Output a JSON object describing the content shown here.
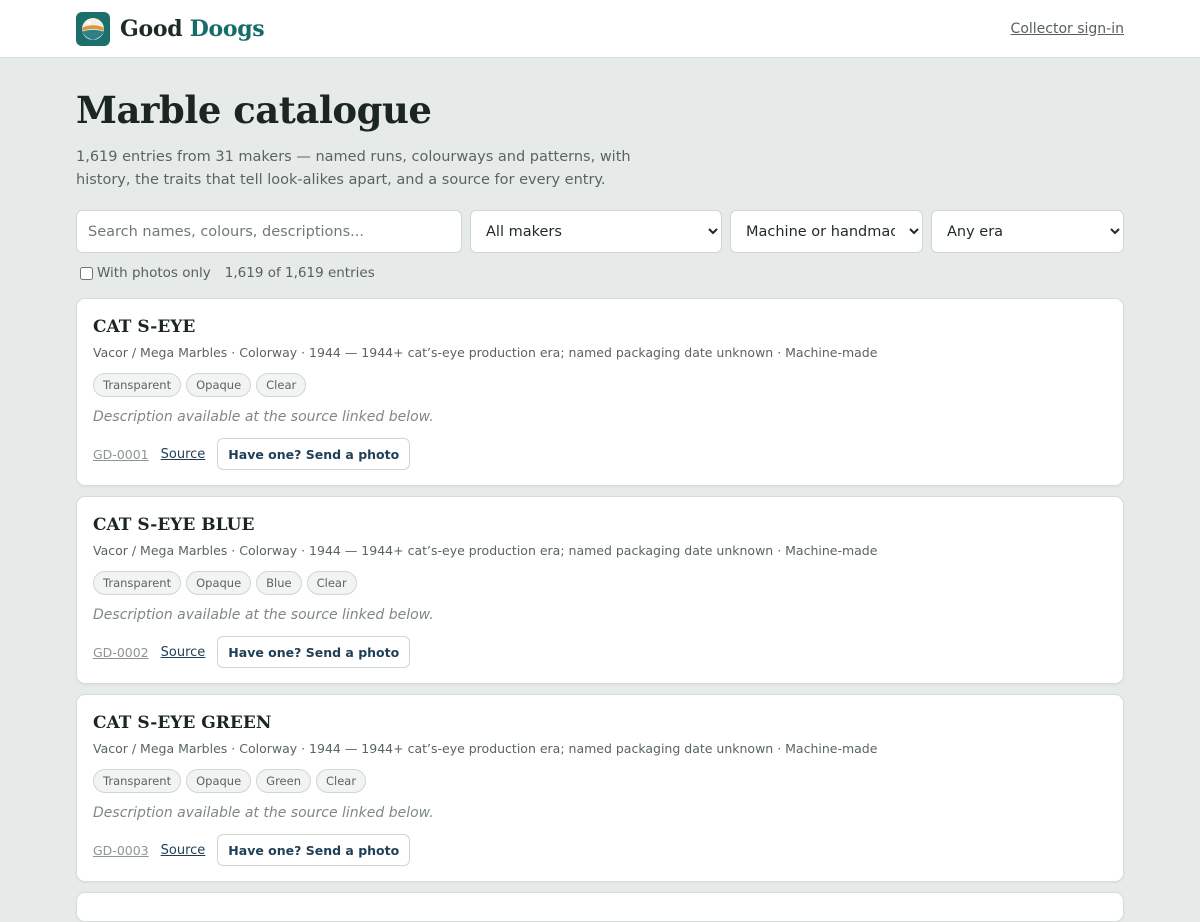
{
  "brand": {
    "name_part1": "Good",
    "name_part2": "Doogs"
  },
  "header": {
    "signin_label": "Collector sign-in"
  },
  "page": {
    "title": "Marble catalogue",
    "intro": "1,619 entries from 31 makers — named runs, colourways and patterns, with history, the traits that tell look-alikes apart, and a source for every entry."
  },
  "filters": {
    "search_placeholder": "Search names, colours, descriptions...",
    "maker_selected": "All makers",
    "method_selected": "Machine or handmade",
    "era_selected": "Any era",
    "photos_only_label": "With photos only",
    "photos_only_checked": false,
    "count_text": "1,619 of 1,619 entries"
  },
  "entries": [
    {
      "name": "CAT S-EYE",
      "meta": "Vacor / Mega Marbles · Colorway · 1944 — 1944+ cat’s-eye production era; named packaging date unknown · Machine-made",
      "tags": [
        "Transparent",
        "Opaque",
        "Clear"
      ],
      "description": "Description available at the source linked below.",
      "id": "GD-0001",
      "source_label": "Source",
      "action_label": "Have one? Send a photo"
    },
    {
      "name": "CAT S-EYE BLUE",
      "meta": "Vacor / Mega Marbles · Colorway · 1944 — 1944+ cat’s-eye production era; named packaging date unknown · Machine-made",
      "tags": [
        "Transparent",
        "Opaque",
        "Blue",
        "Clear"
      ],
      "description": "Description available at the source linked below.",
      "id": "GD-0002",
      "source_label": "Source",
      "action_label": "Have one? Send a photo"
    },
    {
      "name": "CAT S-EYE GREEN",
      "meta": "Vacor / Mega Marbles · Colorway · 1944 — 1944+ cat’s-eye production era; named packaging date unknown · Machine-made",
      "tags": [
        "Transparent",
        "Opaque",
        "Green",
        "Clear"
      ],
      "description": "Description available at the source linked below.",
      "id": "GD-0003",
      "source_label": "Source",
      "action_label": "Have one? Send a photo"
    }
  ],
  "icons": {
    "logo": "marble-logo-icon"
  },
  "colors": {
    "accent": "#176b6a",
    "page_bg": "#e6ebe9",
    "link": "#1f3f56"
  }
}
